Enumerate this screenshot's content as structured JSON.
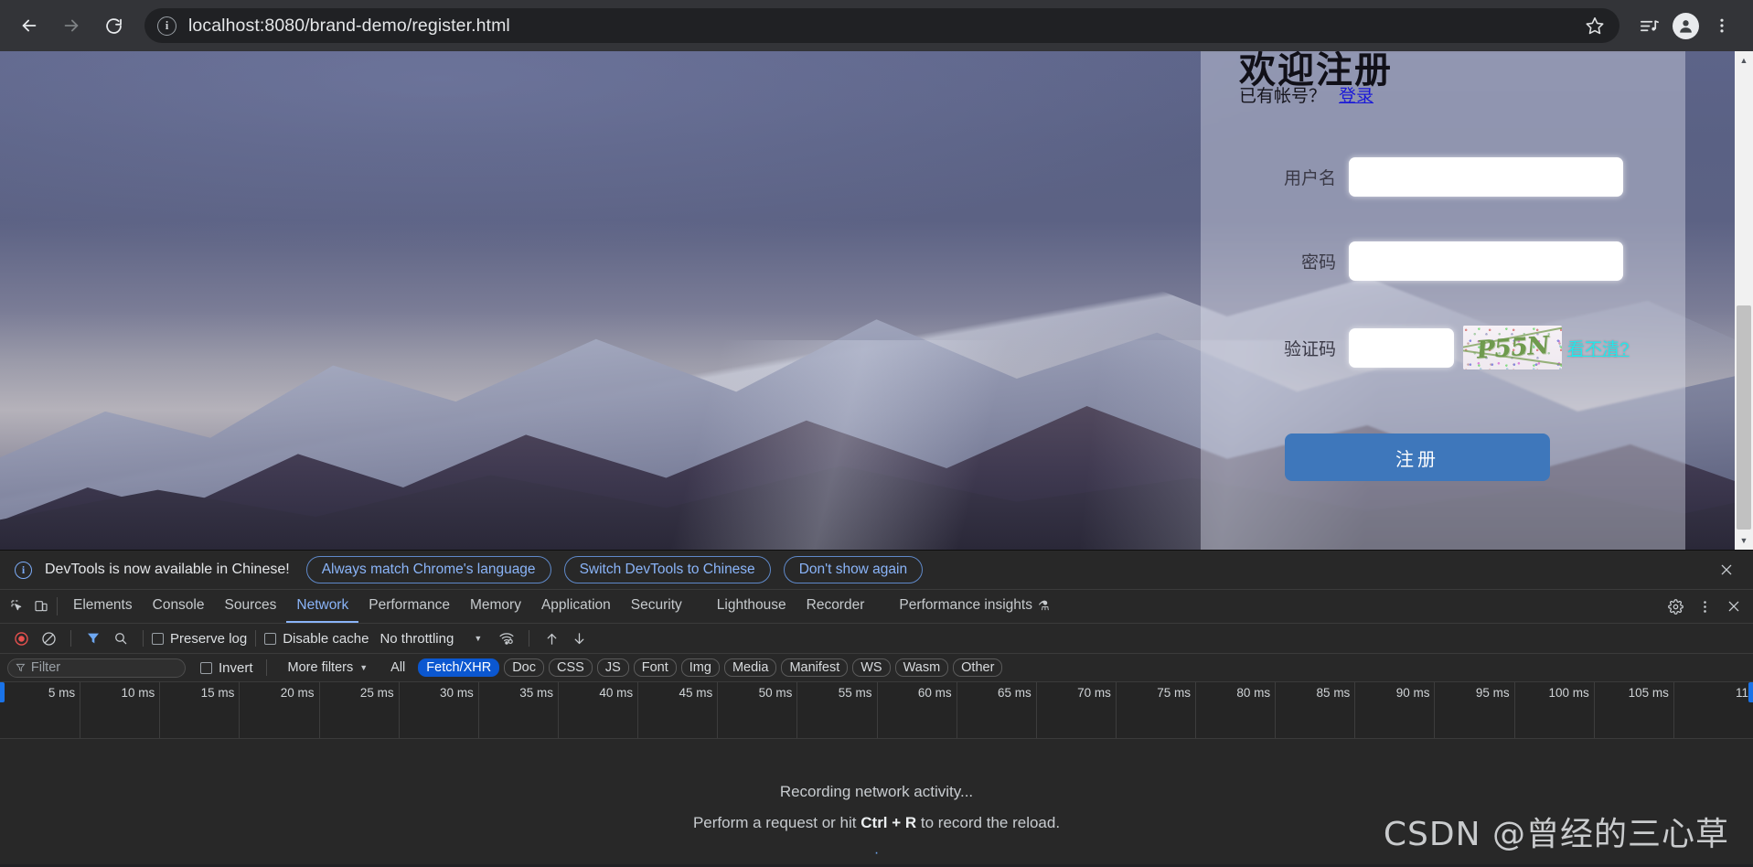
{
  "browser": {
    "back_label": "Back",
    "forward_label": "Forward",
    "reload_label": "Reload",
    "url": "localhost:8080/brand-demo/register.html",
    "site_info_label": "View site information",
    "bookmark_label": "Bookmark this tab",
    "media_label": "Media controls",
    "profile_label": "Profile",
    "menu_label": "Customize and control Google Chrome"
  },
  "register": {
    "title": "欢迎注册",
    "have_account": "已有帐号？",
    "login_link": "登录",
    "username_label": "用户名",
    "username_value": "",
    "password_label": "密码",
    "password_value": "",
    "captcha_label": "验证码",
    "captcha_value": "",
    "captcha_code": "P55N",
    "refresh_link": "看不清?",
    "submit_label": "注册",
    "button_color": "#3e77bb",
    "link_color": "#1a18d8",
    "refresh_color": "#25e6ea"
  },
  "devtools": {
    "notice": {
      "message": "DevTools is now available in Chinese!",
      "buttons": [
        "Always match Chrome's language",
        "Switch DevTools to Chinese",
        "Don't show again"
      ],
      "close_label": "Close"
    },
    "tabs": [
      {
        "label": "Elements",
        "active": false
      },
      {
        "label": "Console",
        "active": false
      },
      {
        "label": "Sources",
        "active": false
      },
      {
        "label": "Network",
        "active": true
      },
      {
        "label": "Performance",
        "active": false
      },
      {
        "label": "Memory",
        "active": false
      },
      {
        "label": "Application",
        "active": false
      },
      {
        "label": "Security",
        "active": false
      }
    ],
    "tabs2": [
      {
        "label": "Lighthouse",
        "active": false
      },
      {
        "label": "Recorder",
        "active": false
      }
    ],
    "tabs3": [
      {
        "label": "Performance insights",
        "active": false,
        "badge": "⚗"
      }
    ],
    "accent_color": "#8ab4f8",
    "header_icons": [
      "inspect-icon",
      "device-toolbar-icon"
    ],
    "right_icons": [
      "settings-gear-icon",
      "more-options-icon",
      "close-icon"
    ],
    "network_toolbar": {
      "record_label": "Stop recording network log",
      "clear_label": "Clear network log",
      "filter_toggle_label": "Filter",
      "search_label": "Search",
      "preserve_log_label": "Preserve log",
      "preserve_log_checked": false,
      "disable_cache_label": "Disable cache",
      "disable_cache_checked": false,
      "throttling_value": "No throttling",
      "wifi_label": "Network conditions",
      "import_label": "Import HAR file",
      "export_label": "Export HAR file"
    },
    "filter_bar": {
      "filter_placeholder": "Filter",
      "filter_value": "",
      "invert_label": "Invert",
      "invert_checked": false,
      "more_filters_label": "More filters",
      "types": [
        {
          "label": "All",
          "active": false
        },
        {
          "label": "Fetch/XHR",
          "active": true
        },
        {
          "label": "Doc",
          "active": false
        },
        {
          "label": "CSS",
          "active": false
        },
        {
          "label": "JS",
          "active": false
        },
        {
          "label": "Font",
          "active": false
        },
        {
          "label": "Img",
          "active": false
        },
        {
          "label": "Media",
          "active": false
        },
        {
          "label": "Manifest",
          "active": false
        },
        {
          "label": "WS",
          "active": false
        },
        {
          "label": "Wasm",
          "active": false
        },
        {
          "label": "Other",
          "active": false
        }
      ]
    },
    "timeline": {
      "ticks": [
        "5 ms",
        "10 ms",
        "15 ms",
        "20 ms",
        "25 ms",
        "30 ms",
        "35 ms",
        "40 ms",
        "45 ms",
        "50 ms",
        "55 ms",
        "60 ms",
        "65 ms",
        "70 ms",
        "75 ms",
        "80 ms",
        "85 ms",
        "90 ms",
        "95 ms",
        "100 ms",
        "105 ms",
        "11"
      ],
      "unit": "ms",
      "interval": 5,
      "max": 110
    },
    "empty_state": {
      "line1": "Recording network activity...",
      "line2_pre": "Perform a request or hit ",
      "line2_key": "Ctrl + R",
      "line2_post": " to record the reload."
    }
  },
  "watermark": "CSDN @曾经的三心草"
}
